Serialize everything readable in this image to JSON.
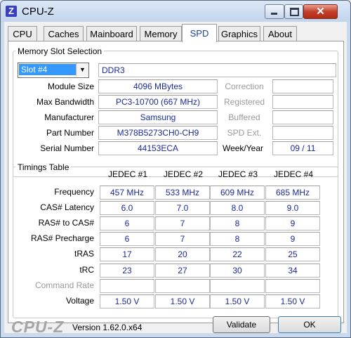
{
  "window": {
    "title": "CPU-Z",
    "app_icon_letter": "Z",
    "close_glyph": "✕"
  },
  "tabs": [
    "CPU",
    "Caches",
    "Mainboard",
    "Memory",
    "SPD",
    "Graphics",
    "About"
  ],
  "active_tab": "SPD",
  "memory_slot_selection": {
    "legend": "Memory Slot Selection",
    "slot_selected": "Slot #4",
    "memory_type": "DDR3",
    "labels": {
      "module_size": "Module Size",
      "max_bandwidth": "Max Bandwidth",
      "manufacturer": "Manufacturer",
      "part_number": "Part Number",
      "serial_number": "Serial Number",
      "correction": "Correction",
      "registered": "Registered",
      "buffered": "Buffered",
      "spd_ext": "SPD Ext.",
      "week_year": "Week/Year"
    },
    "values": {
      "module_size": "4096 MBytes",
      "max_bandwidth": "PC3-10700 (667 MHz)",
      "manufacturer": "Samsung",
      "part_number": "M378B5273CH0-CH9",
      "serial_number": "44153ECA",
      "correction": "",
      "registered": "",
      "buffered": "",
      "spd_ext": "",
      "week_year": "09 / 11"
    }
  },
  "timings": {
    "legend": "Timings Table",
    "columns": [
      "JEDEC #1",
      "JEDEC #2",
      "JEDEC #3",
      "JEDEC #4"
    ],
    "rows": [
      {
        "label": "Frequency",
        "dim": false,
        "values": [
          "457 MHz",
          "533 MHz",
          "609 MHz",
          "685 MHz"
        ]
      },
      {
        "label": "CAS# Latency",
        "dim": false,
        "values": [
          "6.0",
          "7.0",
          "8.0",
          "9.0"
        ]
      },
      {
        "label": "RAS# to CAS#",
        "dim": false,
        "values": [
          "6",
          "7",
          "8",
          "9"
        ]
      },
      {
        "label": "RAS# Precharge",
        "dim": false,
        "values": [
          "6",
          "7",
          "8",
          "9"
        ]
      },
      {
        "label": "tRAS",
        "dim": false,
        "values": [
          "17",
          "20",
          "22",
          "25"
        ]
      },
      {
        "label": "tRC",
        "dim": false,
        "values": [
          "23",
          "27",
          "30",
          "34"
        ]
      },
      {
        "label": "Command Rate",
        "dim": true,
        "values": [
          "",
          "",
          "",
          ""
        ]
      },
      {
        "label": "Voltage",
        "dim": false,
        "values": [
          "1.50 V",
          "1.50 V",
          "1.50 V",
          "1.50 V"
        ]
      }
    ]
  },
  "footer": {
    "logo": "CPU-Z",
    "version": "Version 1.62.0.x64",
    "validate_label": "Validate",
    "ok_label": "OK"
  }
}
